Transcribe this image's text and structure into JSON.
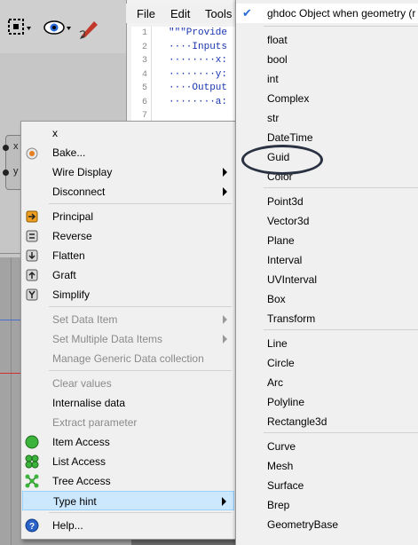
{
  "editor": {
    "menu": [
      "File",
      "Edit",
      "Tools"
    ],
    "code_lines": [
      {
        "num": "1",
        "text": "\"\"\"Provide"
      },
      {
        "num": "2",
        "text": "····Inputs"
      },
      {
        "num": "3",
        "text": "········x:"
      },
      {
        "num": "4",
        "text": "········y:"
      },
      {
        "num": "5",
        "text": "····Output"
      },
      {
        "num": "6",
        "text": "········a:"
      },
      {
        "num": "7",
        "text": ""
      }
    ]
  },
  "node": {
    "inputs": [
      "x",
      "y"
    ]
  },
  "context_menu": {
    "header": "x",
    "items": [
      {
        "label": "Bake...",
        "icon": "bake-icon",
        "disabled": false,
        "submenu": false
      },
      {
        "label": "Wire Display",
        "icon": "",
        "disabled": false,
        "submenu": true
      },
      {
        "label": "Disconnect",
        "icon": "",
        "disabled": false,
        "submenu": true
      },
      {
        "label": "Principal",
        "icon": "principal-icon",
        "disabled": false,
        "submenu": false
      },
      {
        "label": "Reverse",
        "icon": "reverse-icon",
        "disabled": false,
        "submenu": false
      },
      {
        "label": "Flatten",
        "icon": "flatten-icon",
        "disabled": false,
        "submenu": false
      },
      {
        "label": "Graft",
        "icon": "graft-icon",
        "disabled": false,
        "submenu": false
      },
      {
        "label": "Simplify",
        "icon": "simplify-icon",
        "disabled": false,
        "submenu": false
      },
      {
        "label": "Set Data Item",
        "icon": "",
        "disabled": true,
        "submenu": true
      },
      {
        "label": "Set Multiple Data Items",
        "icon": "",
        "disabled": true,
        "submenu": true
      },
      {
        "label": "Manage Generic Data collection",
        "icon": "",
        "disabled": true,
        "submenu": false
      },
      {
        "label": "Clear values",
        "icon": "",
        "disabled": true,
        "submenu": false
      },
      {
        "label": "Internalise data",
        "icon": "",
        "disabled": false,
        "submenu": false
      },
      {
        "label": "Extract parameter",
        "icon": "",
        "disabled": true,
        "submenu": false
      },
      {
        "label": "Item Access",
        "icon": "item-access-icon",
        "disabled": false,
        "submenu": false
      },
      {
        "label": "List Access",
        "icon": "list-access-icon",
        "disabled": false,
        "submenu": false
      },
      {
        "label": "Tree Access",
        "icon": "tree-access-icon",
        "disabled": false,
        "submenu": false
      },
      {
        "label": "Type hint",
        "icon": "",
        "disabled": false,
        "submenu": true
      },
      {
        "label": "Help...",
        "icon": "help-icon",
        "disabled": false,
        "submenu": false
      }
    ]
  },
  "type_hint_menu": {
    "checked_item": "ghdoc Object when geometry (r",
    "items": [
      "float",
      "bool",
      "int",
      "Complex",
      "str",
      "DateTime",
      "Guid",
      "Color",
      "Point3d",
      "Vector3d",
      "Plane",
      "Interval",
      "UVInterval",
      "Box",
      "Transform",
      "Line",
      "Circle",
      "Arc",
      "Polyline",
      "Rectangle3d",
      "Curve",
      "Mesh",
      "Surface",
      "Brep",
      "GeometryBase"
    ],
    "circled_item": "Guid"
  },
  "colors": {
    "highlight": "#cce8ff",
    "highlight_border": "#99d1ff",
    "annotation_ring": "#2a3242",
    "code_blue": "#1a35b0"
  }
}
